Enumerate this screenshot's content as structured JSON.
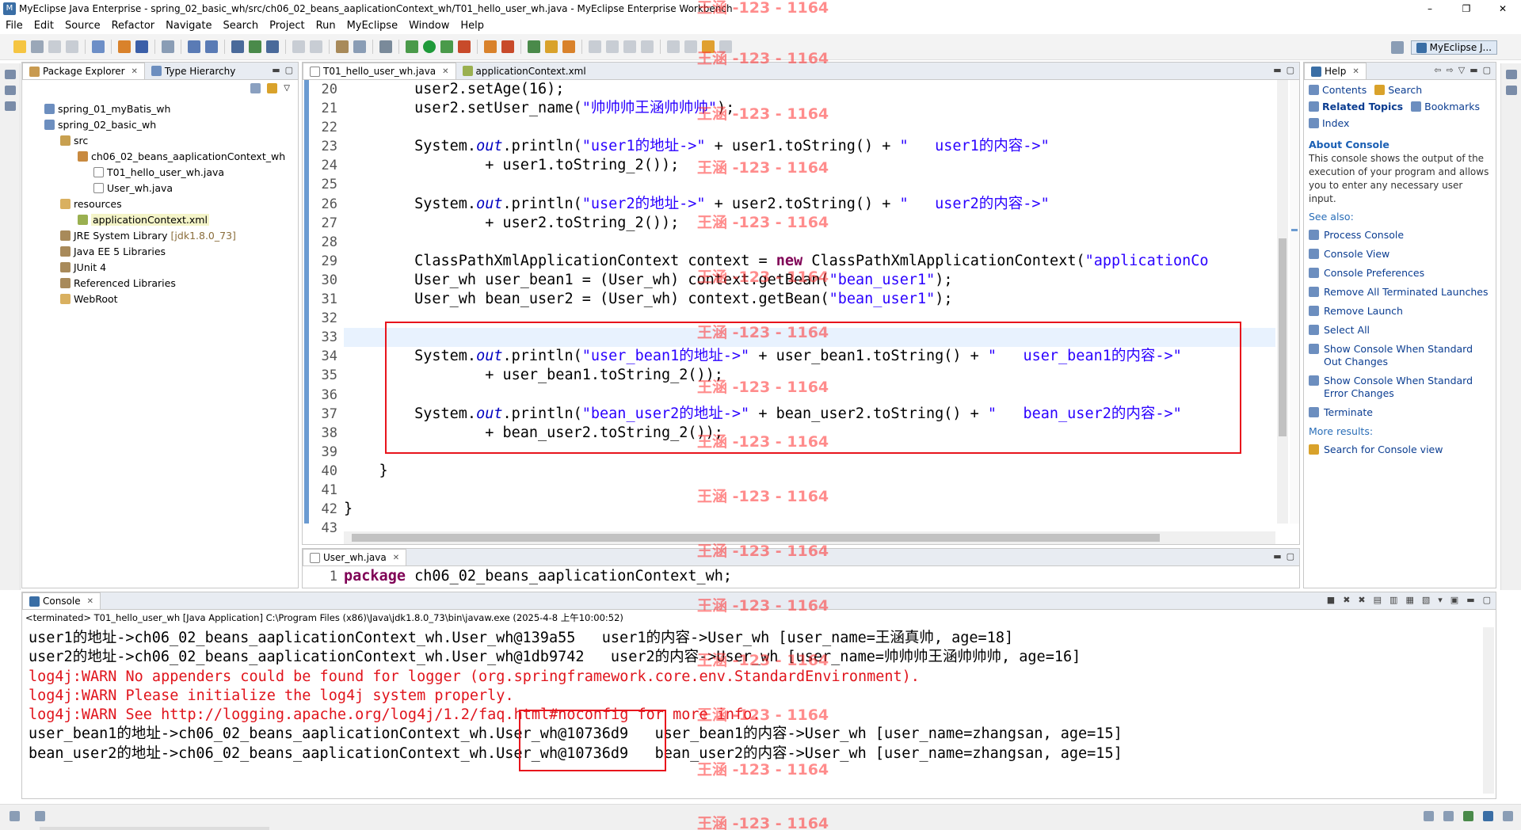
{
  "window": {
    "title": "MyEclipse Java Enterprise - spring_02_basic_wh/src/ch06_02_beans_aaplicationContext_wh/T01_hello_user_wh.java - MyEclipse Enterprise Workbench",
    "minimize": "–",
    "maximize": "❐",
    "close": "✕"
  },
  "menu": [
    "File",
    "Edit",
    "Source",
    "Refactor",
    "Navigate",
    "Search",
    "Project",
    "Run",
    "MyEclipse",
    "Window",
    "Help"
  ],
  "perspective": {
    "label": "MyEclipse J..."
  },
  "watermark": "王涵 -123 - 1164",
  "package_explorer": {
    "tab_label": "Package Explorer",
    "tab2_label": "Type Hierarchy",
    "items": [
      {
        "label": "spring_01_myBatis_wh",
        "icon": "project-icon"
      },
      {
        "label": "spring_02_basic_wh",
        "icon": "project-icon"
      },
      {
        "label": "src",
        "icon": "source-folder-icon"
      },
      {
        "label": "ch06_02_beans_aaplicationContext_wh",
        "icon": "package-icon"
      },
      {
        "label": "T01_hello_user_wh.java",
        "icon": "java-file-icon"
      },
      {
        "label": "User_wh.java",
        "icon": "java-file-icon"
      },
      {
        "label": "resources",
        "icon": "folder-icon"
      },
      {
        "label": "applicationContext.xml",
        "icon": "xml-file-icon"
      },
      {
        "label": "JRE System Library",
        "decoration": "[jdk1.8.0_73]",
        "icon": "library-icon"
      },
      {
        "label": "Java EE 5 Libraries",
        "icon": "library-icon"
      },
      {
        "label": "JUnit 4",
        "icon": "library-icon"
      },
      {
        "label": "Referenced Libraries",
        "icon": "library-icon"
      },
      {
        "label": "WebRoot",
        "icon": "folder-icon"
      }
    ]
  },
  "editor": {
    "tabs": [
      {
        "label": "T01_hello_user_wh.java",
        "icon": "java-file-icon"
      },
      {
        "label": "applicationContext.xml",
        "icon": "xml-file-icon"
      }
    ],
    "line_numbers": [
      "20",
      "21",
      "22",
      "23",
      "24",
      "25",
      "26",
      "27",
      "28",
      "29",
      "30",
      "31",
      "32",
      "33",
      "34",
      "35",
      "36",
      "37",
      "38",
      "39",
      "40",
      "41",
      "42",
      "43"
    ]
  },
  "editor2": {
    "tab_label": "User_wh.java",
    "line_number": "1",
    "code_kw": "package",
    "code_rest": " ch06_02_beans_aaplicationContext_wh;"
  },
  "help": {
    "tab_label": "Help",
    "contents": "Contents",
    "search": "Search",
    "related": "Related Topics",
    "bookmarks": "Bookmarks",
    "index": "Index",
    "about_title": "About Console",
    "about_text": "This console shows the output of the execution of your program and allows you to enter any necessary user input.",
    "see_also": "See also:",
    "links": [
      "Process Console",
      "Console View",
      "Console Preferences",
      "Remove All Terminated Launches",
      "Remove Launch",
      "Select All",
      "Show Console When Standard Out Changes",
      "Show Console When Standard Error Changes",
      "Terminate"
    ],
    "more_results": "More results:",
    "search_console": "Search for Console view"
  },
  "console": {
    "tab_label": "Console",
    "status": "<terminated> T01_hello_user_wh [Java Application] C:\\Program Files (x86)\\Java\\jdk1.8.0_73\\bin\\javaw.exe (2025-4-8 上午10:00:52)",
    "lines": [
      {
        "text": "user1的地址->ch06_02_beans_aaplicationContext_wh.User_wh@139a55   user1的内容->User_wh [user_name=王涵真帅, age=18]",
        "error": false
      },
      {
        "text": "user2的地址->ch06_02_beans_aaplicationContext_wh.User_wh@1db9742   user2的内容->User_wh [user_name=帅帅帅王涵帅帅帅, age=16]",
        "error": false
      },
      {
        "text": "log4j:WARN No appenders could be found for logger (org.springframework.core.env.StandardEnvironment).",
        "error": true
      },
      {
        "text": "log4j:WARN Please initialize the log4j system properly.",
        "error": true
      },
      {
        "text": "log4j:WARN See http://logging.apache.org/log4j/1.2/faq.html#noconfig for more info.",
        "error": true
      },
      {
        "text": "user_bean1的地址->ch06_02_beans_aaplicationContext_wh.User_wh@10736d9   user_bean1的内容->User_wh [user_name=zhangsan, age=15]",
        "error": false
      },
      {
        "text": "bean_user2的地址->ch06_02_beans_aaplicationContext_wh.User_wh@10736d9   bean_user2的内容->User_wh [user_name=zhangsan, age=15]",
        "error": false
      }
    ]
  },
  "colors": {
    "keyword": "#7f0055",
    "string": "#2a00ff",
    "field": "#0000c0",
    "error": "#e0141c",
    "highlight_box": "#e8141c"
  }
}
